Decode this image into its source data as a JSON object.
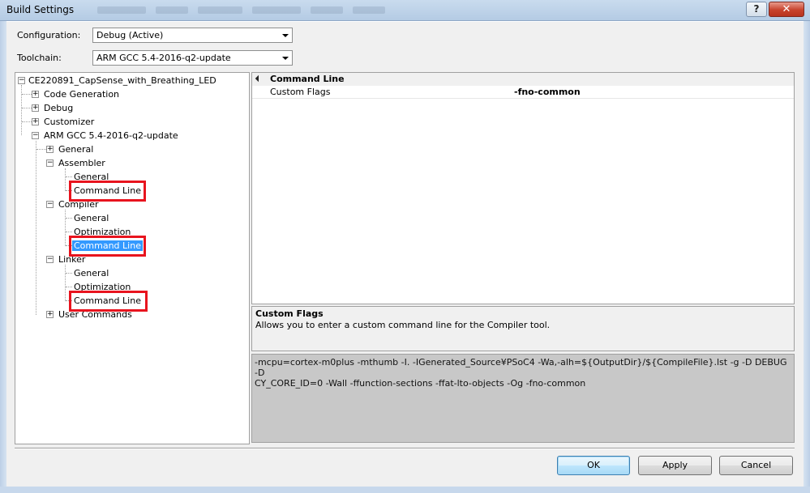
{
  "window": {
    "title": "Build Settings",
    "help_label": "?",
    "close_label": "✕"
  },
  "config": {
    "configuration_label": "Configuration:",
    "configuration_value": "Debug (Active)",
    "toolchain_label": "Toolchain:",
    "toolchain_value": "ARM GCC 5.4-2016-q2-update"
  },
  "tree": {
    "root": "CE220891_CapSense_with_Breathing_LED",
    "code_generation": "Code Generation",
    "debug": "Debug",
    "customizer": "Customizer",
    "arm_gcc": "ARM GCC 5.4-2016-q2-update",
    "general": "General",
    "assembler": "Assembler",
    "assembler_general": "General",
    "assembler_command_line": "Command Line",
    "compiler": "Compiler",
    "compiler_general": "General",
    "compiler_optimization": "Optimization",
    "compiler_command_line": "Command Line",
    "linker": "Linker",
    "linker_general": "General",
    "linker_optimization": "Optimization",
    "linker_command_line": "Command Line",
    "user_commands": "User Commands",
    "expand_glyph": "+",
    "collapse_glyph": "−"
  },
  "property_grid": {
    "category": "Command Line",
    "property_name": "Custom Flags",
    "property_value": "-fno-common"
  },
  "description": {
    "title": "Custom Flags",
    "text": "Allows you to enter a custom command line for the Compiler tool."
  },
  "command_line": {
    "line1": "-mcpu=cortex-m0plus -mthumb -I. -IGenerated_Source¥PSoC4 -Wa,-alh=${OutputDir}/${CompileFile}.lst -g -D DEBUG -D",
    "line2": "CY_CORE_ID=0 -Wall -ffunction-sections -ffat-lto-objects -Og -fno-common"
  },
  "buttons": {
    "ok": "OK",
    "apply": "Apply",
    "cancel": "Cancel"
  },
  "colors": {
    "selection": "#3399ff",
    "highlight_box": "#e8141e"
  }
}
